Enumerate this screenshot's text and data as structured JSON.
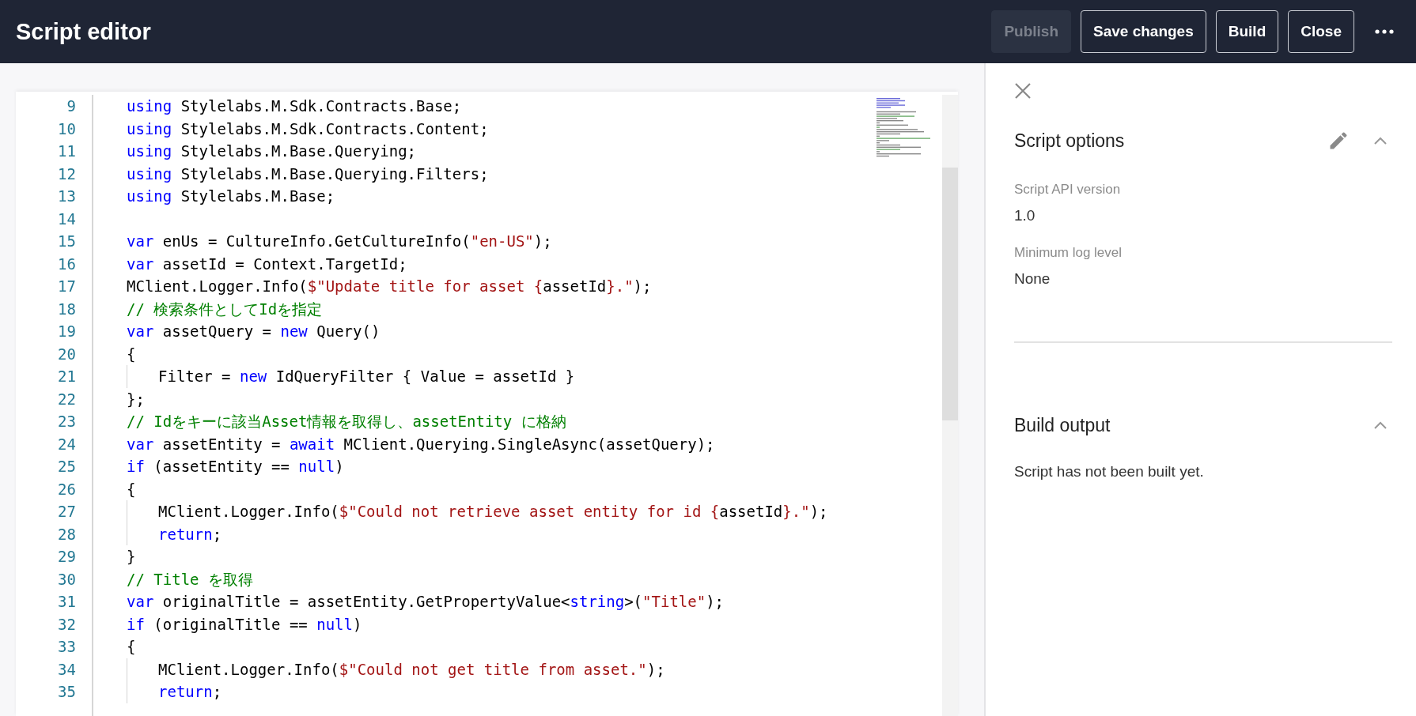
{
  "header": {
    "title": "Script editor",
    "buttons": [
      {
        "label": "Publish",
        "disabled": true
      },
      {
        "label": "Save changes",
        "disabled": false
      },
      {
        "label": "Build",
        "disabled": false
      },
      {
        "label": "Close",
        "disabled": false
      }
    ]
  },
  "editor": {
    "lines": [
      {
        "number": "9",
        "tokens": [
          {
            "kind": "keyword",
            "text": "using"
          },
          {
            "kind": "plain",
            "text": " Stylelabs.M.Sdk.Contracts.Base;"
          }
        ]
      },
      {
        "number": "10",
        "tokens": [
          {
            "kind": "keyword",
            "text": "using"
          },
          {
            "kind": "plain",
            "text": " Stylelabs.M.Sdk.Contracts.Content;"
          }
        ]
      },
      {
        "number": "11",
        "tokens": [
          {
            "kind": "keyword",
            "text": "using"
          },
          {
            "kind": "plain",
            "text": " Stylelabs.M.Base.Querying;"
          }
        ]
      },
      {
        "number": "12",
        "tokens": [
          {
            "kind": "keyword",
            "text": "using"
          },
          {
            "kind": "plain",
            "text": " Stylelabs.M.Base.Querying.Filters;"
          }
        ]
      },
      {
        "number": "13",
        "tokens": [
          {
            "kind": "keyword",
            "text": "using"
          },
          {
            "kind": "plain",
            "text": " Stylelabs.M.Base;"
          }
        ]
      },
      {
        "number": "14"
      },
      {
        "number": "15",
        "tokens": [
          {
            "kind": "keyword",
            "text": "var"
          },
          {
            "kind": "plain",
            "text": " enUs = CultureInfo.GetCultureInfo("
          },
          {
            "kind": "string",
            "text": "\"en-US\""
          },
          {
            "kind": "plain",
            "text": ");"
          }
        ]
      },
      {
        "number": "16",
        "tokens": [
          {
            "kind": "keyword",
            "text": "var"
          },
          {
            "kind": "plain",
            "text": " assetId = Context.TargetId;"
          }
        ]
      },
      {
        "number": "17",
        "tokens": [
          {
            "kind": "plain",
            "text": "MClient.Logger.Info("
          },
          {
            "kind": "string",
            "text": "$\"Update title for asset {"
          },
          {
            "kind": "plain",
            "text": "assetId"
          },
          {
            "kind": "string",
            "text": "}.\""
          },
          {
            "kind": "plain",
            "text": ");"
          }
        ]
      },
      {
        "number": "18",
        "tokens": [
          {
            "kind": "comment",
            "text": "// 検索条件としてIdを指定"
          }
        ]
      },
      {
        "number": "19",
        "tokens": [
          {
            "kind": "keyword",
            "text": "var"
          },
          {
            "kind": "plain",
            "text": " assetQuery = "
          },
          {
            "kind": "keyword",
            "text": "new"
          },
          {
            "kind": "plain",
            "text": " Query()"
          }
        ]
      },
      {
        "number": "20",
        "tokens": [
          {
            "kind": "plain",
            "text": "{"
          }
        ]
      },
      {
        "number": "21",
        "indented": true,
        "tokens": [
          {
            "kind": "plain",
            "text": "Filter = "
          },
          {
            "kind": "keyword",
            "text": "new"
          },
          {
            "kind": "plain",
            "text": " IdQueryFilter { Value = assetId }"
          }
        ]
      },
      {
        "number": "22",
        "tokens": [
          {
            "kind": "plain",
            "text": "};"
          }
        ]
      },
      {
        "number": "23",
        "tokens": [
          {
            "kind": "comment",
            "text": "// Idをキーに該当Asset情報を取得し、assetEntity に格納"
          }
        ]
      },
      {
        "number": "24",
        "tokens": [
          {
            "kind": "keyword",
            "text": "var"
          },
          {
            "kind": "plain",
            "text": " assetEntity = "
          },
          {
            "kind": "keyword",
            "text": "await"
          },
          {
            "kind": "plain",
            "text": " MClient.Querying.SingleAsync(assetQuery);"
          }
        ]
      },
      {
        "number": "25",
        "tokens": [
          {
            "kind": "keyword",
            "text": "if"
          },
          {
            "kind": "plain",
            "text": " (assetEntity == "
          },
          {
            "kind": "keyword",
            "text": "null"
          },
          {
            "kind": "plain",
            "text": ")"
          }
        ]
      },
      {
        "number": "26",
        "tokens": [
          {
            "kind": "plain",
            "text": "{"
          }
        ]
      },
      {
        "number": "27",
        "indented": true,
        "tokens": [
          {
            "kind": "plain",
            "text": "MClient.Logger.Info("
          },
          {
            "kind": "string",
            "text": "$\"Could not retrieve asset entity for id {"
          },
          {
            "kind": "plain",
            "text": "assetId"
          },
          {
            "kind": "string",
            "text": "}.\""
          },
          {
            "kind": "plain",
            "text": ");"
          }
        ]
      },
      {
        "number": "28",
        "indented": true,
        "tokens": [
          {
            "kind": "keyword",
            "text": "return"
          },
          {
            "kind": "plain",
            "text": ";"
          }
        ]
      },
      {
        "number": "29",
        "tokens": [
          {
            "kind": "plain",
            "text": "}"
          }
        ]
      },
      {
        "number": "30",
        "tokens": [
          {
            "kind": "comment",
            "text": "// Title を取得"
          }
        ]
      },
      {
        "number": "31",
        "tokens": [
          {
            "kind": "keyword",
            "text": "var"
          },
          {
            "kind": "plain",
            "text": " originalTitle = assetEntity.GetPropertyValue<"
          },
          {
            "kind": "keyword",
            "text": "string"
          },
          {
            "kind": "plain",
            "text": ">("
          },
          {
            "kind": "string",
            "text": "\"Title\""
          },
          {
            "kind": "plain",
            "text": ");"
          }
        ]
      },
      {
        "number": "32",
        "tokens": [
          {
            "kind": "keyword",
            "text": "if"
          },
          {
            "kind": "plain",
            "text": " (originalTitle == "
          },
          {
            "kind": "keyword",
            "text": "null"
          },
          {
            "kind": "plain",
            "text": ")"
          }
        ]
      },
      {
        "number": "33",
        "tokens": [
          {
            "kind": "plain",
            "text": "{"
          }
        ]
      },
      {
        "number": "34",
        "indented": true,
        "tokens": [
          {
            "kind": "plain",
            "text": "MClient.Logger.Info("
          },
          {
            "kind": "string",
            "text": "$\"Could not get title from asset.\""
          },
          {
            "kind": "plain",
            "text": ");"
          }
        ]
      },
      {
        "number": "35",
        "indented": true,
        "tokens": [
          {
            "kind": "keyword",
            "text": "return"
          },
          {
            "kind": "plain",
            "text": ";"
          }
        ]
      }
    ]
  },
  "side_panel": {
    "sections": [
      {
        "title": "Script options",
        "expanded": true,
        "editable": true,
        "fields": [
          {
            "label": "Script API version",
            "value": "1.0"
          },
          {
            "label": "Minimum log level",
            "value": "None"
          }
        ]
      },
      {
        "title": "Build output",
        "expanded": true,
        "editable": false,
        "message": "Script has not been built yet."
      }
    ]
  }
}
